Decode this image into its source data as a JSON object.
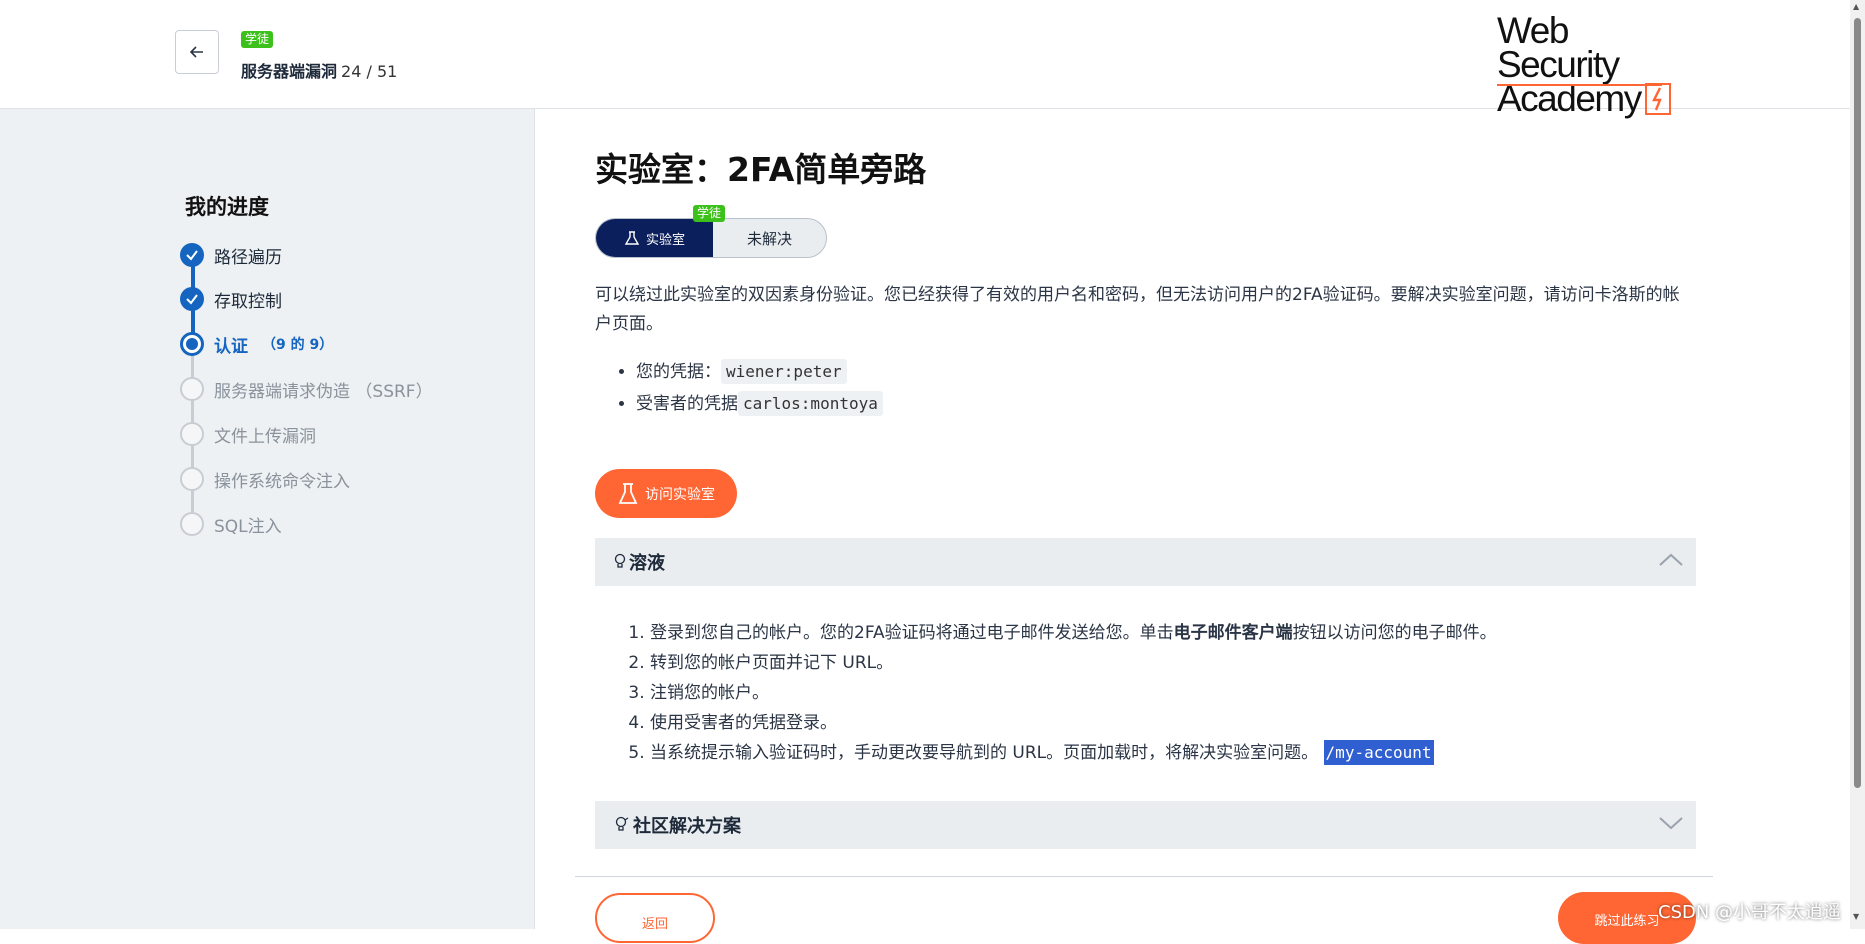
{
  "header": {
    "badge": "学徒",
    "topic": "服务器端漏洞",
    "count": "24 / 51",
    "logo_line1": "Web Security",
    "logo_line2": "Academy"
  },
  "sidebar": {
    "title": "我的进度",
    "items": [
      {
        "label": "路径遍历",
        "state": "done"
      },
      {
        "label": "存取控制",
        "state": "done"
      },
      {
        "label": "认证",
        "sub": "（9 的 9）",
        "state": "current"
      },
      {
        "label": "服务器端请求伪造 （SSRF）",
        "state": "pending"
      },
      {
        "label": "文件上传漏洞",
        "state": "pending"
      },
      {
        "label": "操作系统命令注入",
        "state": "pending"
      },
      {
        "label": "SQL注入",
        "state": "pending"
      }
    ]
  },
  "main": {
    "title": "实验室：2FA简单旁路",
    "status_badge": "学徒",
    "status_lab": "实验室",
    "status_unsolved": "未解决",
    "description": "可以绕过此实验室的双因素身份验证。您已经获得了有效的用户名和密码，但无法访问用户的2FA验证码。要解决实验室问题，请访问卡洛斯的帐户页面。",
    "cred1_label": "您的凭据：",
    "cred1_code": "wiener:peter",
    "cred2_label": "受害者的凭据",
    "cred2_code": "carlos:montoya",
    "access_button": "访问实验室",
    "solution_title": "溶液",
    "solution_steps": {
      "s1_a": "登录到您自己的帐户。您的2FA验证码将通过电子邮件发送给您。单击",
      "s1_b": "电子邮件客户端",
      "s1_c": "按钮以访问您的电子邮件。",
      "s2": "转到您的帐户页面并记下 URL。",
      "s3": "注销您的帐户。",
      "s4": "使用受害者的凭据登录。",
      "s5": "当系统提示输入验证码时，手动更改要导航到的 URL。页面加载时，将解决实验室问题。",
      "s5_code": "/my-account"
    },
    "community_title": "社区解决方案",
    "back_button": "返回",
    "skip_button": "跳过此练习"
  },
  "watermark": "CSDN @小哥不太逍遥",
  "colors": {
    "accent": "#ff6633",
    "primary_blue": "#1565c0",
    "badge_green": "#3cc01a",
    "navy": "#0b1f5c"
  }
}
